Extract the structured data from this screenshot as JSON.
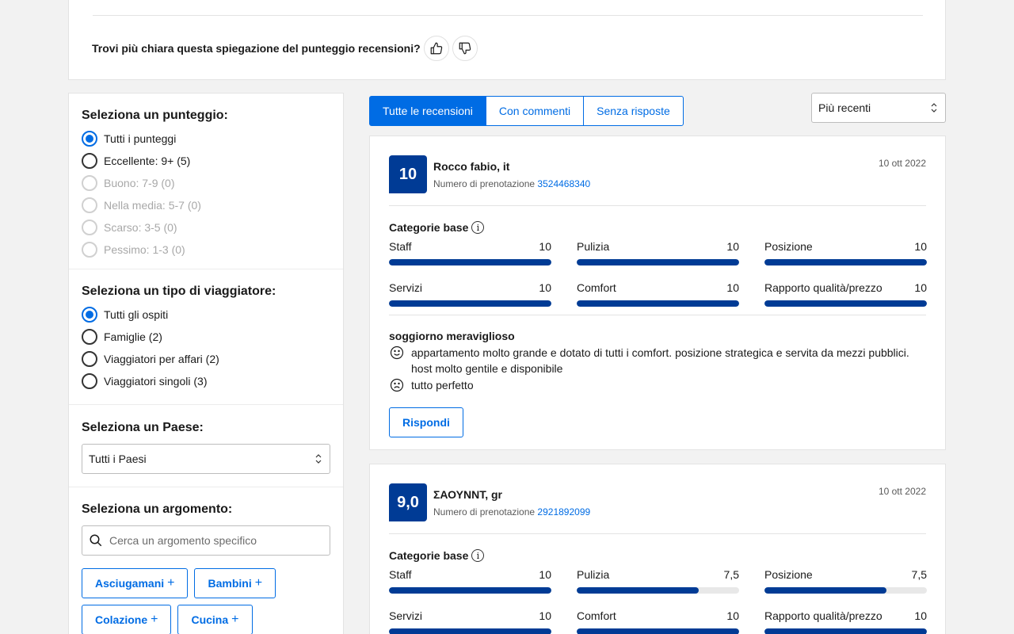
{
  "feedback": {
    "question": "Trovi più chiara questa spiegazione del punteggio recensioni?"
  },
  "filters": {
    "score": {
      "title": "Seleziona un punteggio:",
      "options": [
        {
          "label": "Tutti i punteggi",
          "checked": true,
          "disabled": false
        },
        {
          "label": "Eccellente: 9+ (5)",
          "checked": false,
          "disabled": false
        },
        {
          "label": "Buono: 7-9 (0)",
          "checked": false,
          "disabled": true
        },
        {
          "label": "Nella media: 5-7 (0)",
          "checked": false,
          "disabled": true
        },
        {
          "label": "Scarso: 3-5 (0)",
          "checked": false,
          "disabled": true
        },
        {
          "label": "Pessimo: 1-3 (0)",
          "checked": false,
          "disabled": true
        }
      ]
    },
    "traveler": {
      "title": "Seleziona un tipo di viaggiatore:",
      "options": [
        {
          "label": "Tutti gli ospiti",
          "checked": true
        },
        {
          "label": "Famiglie (2)",
          "checked": false
        },
        {
          "label": "Viaggiatori per affari (2)",
          "checked": false
        },
        {
          "label": "Viaggiatori singoli (3)",
          "checked": false
        }
      ]
    },
    "country": {
      "title": "Seleziona un Paese:",
      "value": "Tutti i Paesi"
    },
    "topic": {
      "title": "Seleziona un argomento:",
      "placeholder": "Cerca un argomento specifico",
      "chips": [
        "Asciugamani",
        "Bambini",
        "Colazione",
        "Cucina"
      ]
    }
  },
  "tabs": [
    {
      "label": "Tutte le recensioni",
      "active": true
    },
    {
      "label": "Con commenti",
      "active": false
    },
    {
      "label": "Senza risposte",
      "active": false
    }
  ],
  "sort": {
    "value": "Più recenti"
  },
  "reviews": [
    {
      "score": "10",
      "name": "Rocco fabio, it",
      "booking_label": "Numero di prenotazione",
      "booking_number": "3524468340",
      "date": "10 ott 2022",
      "categories_title": "Categorie base",
      "categories": [
        {
          "label": "Staff",
          "value": "10",
          "fraction": 1.0
        },
        {
          "label": "Pulizia",
          "value": "10",
          "fraction": 1.0
        },
        {
          "label": "Posizione",
          "value": "10",
          "fraction": 1.0
        },
        {
          "label": "Servizi",
          "value": "10",
          "fraction": 1.0
        },
        {
          "label": "Comfort",
          "value": "10",
          "fraction": 1.0
        },
        {
          "label": "Rapporto qualità/prezzo",
          "value": "10",
          "fraction": 1.0
        }
      ],
      "title": "soggiorno meraviglioso",
      "positive": "appartamento molto grande e dotato di tutti i comfort. posizione strategica e servita da mezzi pubblici. host molto gentile e disponibile",
      "negative": "tutto perfetto",
      "reply_label": "Rispondi"
    },
    {
      "score": "9,0",
      "name": "ΣΑΟΥΝΝΤ, gr",
      "booking_label": "Numero di prenotazione",
      "booking_number": "2921892099",
      "date": "10 ott 2022",
      "categories_title": "Categorie base",
      "categories": [
        {
          "label": "Staff",
          "value": "10",
          "fraction": 1.0
        },
        {
          "label": "Pulizia",
          "value": "7,5",
          "fraction": 0.75
        },
        {
          "label": "Posizione",
          "value": "7,5",
          "fraction": 0.75
        },
        {
          "label": "Servizi",
          "value": "10",
          "fraction": 1.0
        },
        {
          "label": "Comfort",
          "value": "10",
          "fraction": 1.0
        },
        {
          "label": "Rapporto qualità/prezzo",
          "value": "10",
          "fraction": 1.0
        }
      ]
    }
  ]
}
